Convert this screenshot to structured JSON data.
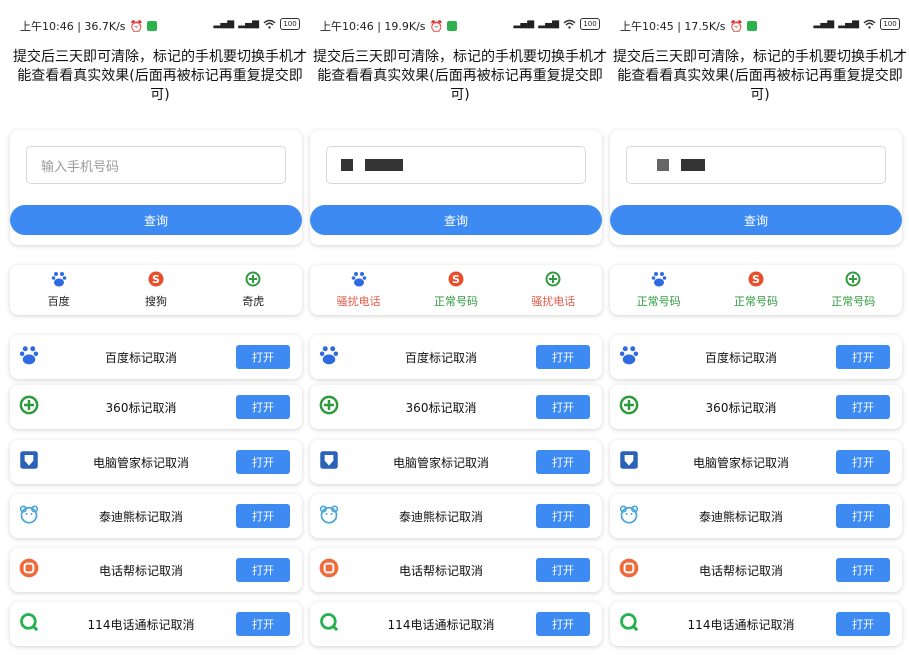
{
  "notice": "提交后三天即可清除，标记的手机要切换手机才能查看看真实效果(后面再被标记再重复提交即可)",
  "engines": [
    "百度",
    "搜狗",
    "奇虎"
  ],
  "rows": [
    {
      "label": "百度标记取消",
      "button": "打开",
      "icon": "baidu-icon"
    },
    {
      "label": "360标记取消",
      "button": "打开",
      "icon": "360-icon"
    },
    {
      "label": "电脑管家标记取消",
      "button": "打开",
      "icon": "tencent-pcmanager-icon"
    },
    {
      "label": "泰迪熊标记取消",
      "button": "打开",
      "icon": "teddy-bear-icon"
    },
    {
      "label": "电话帮标记取消",
      "button": "打开",
      "icon": "dianhuabang-icon"
    },
    {
      "label": "114电话通标记取消",
      "button": "打开",
      "icon": "114-icon"
    }
  ],
  "phones": [
    {
      "status_time": "上午10:46 | 36.7K/s",
      "battery": "100",
      "input_placeholder": "输入手机号码",
      "input_value": "",
      "query_label": "查询",
      "results": [
        "百度",
        "搜狗",
        "奇虎"
      ]
    },
    {
      "status_time": "上午10:46 | 19.9K/s",
      "battery": "100",
      "input_placeholder": "",
      "input_value": "masked",
      "query_label": "查询",
      "results": [
        "骚扰电话",
        "正常号码",
        "骚扰电话"
      ]
    },
    {
      "status_time": "上午10:45 | 17.5K/s",
      "battery": "100",
      "input_placeholder": "",
      "input_value": "masked",
      "query_label": "查询",
      "results": [
        "正常号码",
        "正常号码",
        "正常号码"
      ]
    }
  ],
  "colors": {
    "accent": "#3d8bf2",
    "spam": "#e25c4b",
    "normal": "#2f9b3e"
  }
}
